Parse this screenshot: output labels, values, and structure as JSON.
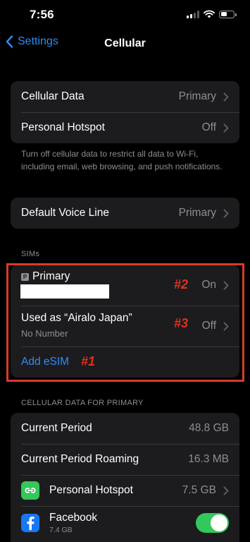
{
  "status_bar": {
    "time": "7:56"
  },
  "nav": {
    "back_label": "Settings",
    "title": "Cellular"
  },
  "group1": {
    "cellular_data": {
      "label": "Cellular Data",
      "value": "Primary"
    },
    "personal_hotspot": {
      "label": "Personal Hotspot",
      "value": "Off"
    }
  },
  "footnote": "Turn off cellular data to restrict all data to Wi-Fi, including email, web browsing, and push notifications.",
  "default_voice": {
    "label": "Default Voice Line",
    "value": "Primary"
  },
  "sims": {
    "header": "SIMs",
    "primary": {
      "badge": "P",
      "name": "Primary",
      "status": "On",
      "annotation": "#2"
    },
    "used": {
      "name": "Used as “Airalo Japan”",
      "number": "No Number",
      "status": "Off",
      "annotation": "#3"
    },
    "add_esim": {
      "label": "Add eSIM",
      "annotation": "#1"
    }
  },
  "usage": {
    "header": "CELLULAR DATA FOR PRIMARY",
    "current_period": {
      "label": "Current Period",
      "value": "48.8 GB"
    },
    "current_period_roaming": {
      "label": "Current Period Roaming",
      "value": "16.3 MB"
    },
    "hotspot": {
      "label": "Personal Hotspot",
      "value": "7.5 GB"
    },
    "facebook": {
      "label": "Facebook",
      "size": "7.4 GB",
      "enabled": true
    }
  },
  "colors": {
    "accent": "#2f8cf6",
    "annotation": "#e0311f",
    "toggle_on": "#34c759"
  }
}
